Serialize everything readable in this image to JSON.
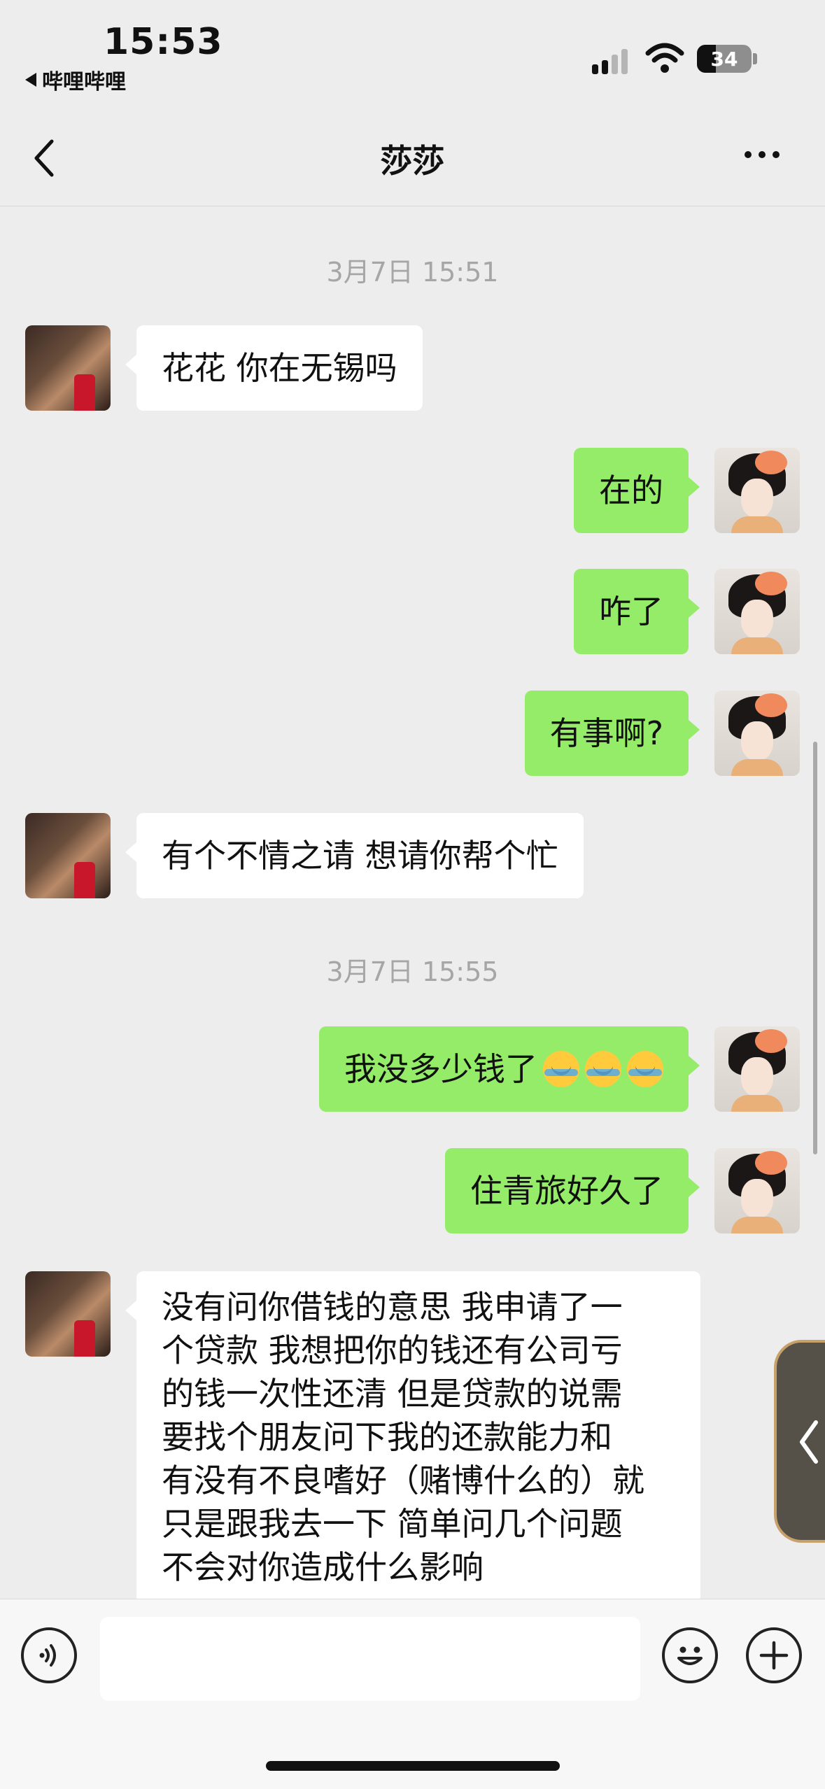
{
  "status_bar": {
    "time": "15:53",
    "back_app": "哔哩哔哩",
    "battery": "34"
  },
  "nav": {
    "title": "莎莎"
  },
  "messages": [
    {
      "type": "timestamp",
      "text": "3月7日 15:51"
    },
    {
      "type": "received",
      "text": "花花 你在无锡吗"
    },
    {
      "type": "sent",
      "text": "在的"
    },
    {
      "type": "sent",
      "text": "咋了"
    },
    {
      "type": "sent",
      "text": "有事啊?"
    },
    {
      "type": "received",
      "text": "有个不情之请 想请你帮个忙"
    },
    {
      "type": "timestamp",
      "text": "3月7日 15:55"
    },
    {
      "type": "sent",
      "text": "我没多少钱了",
      "emoji": [
        "crying-laughing-face",
        "crying-laughing-face",
        "crying-laughing-face"
      ]
    },
    {
      "type": "sent",
      "text": "住青旅好久了"
    },
    {
      "type": "received",
      "lines": [
        "没有问你借钱的意思 我申请了一",
        "个贷款 我想把你的钱还有公司亏",
        "的钱一次性还清 但是贷款的说需",
        "要找个朋友问下我的还款能力和",
        "有没有不良嗜好（赌博什么的）就",
        "只是跟我去一下 简单问几个问题",
        "不会对你造成什么影响"
      ]
    }
  ],
  "input_bar": {
    "placeholder": ""
  },
  "colors": {
    "background": "#ededed",
    "sent_bubble": "#95ec69",
    "received_bubble": "#ffffff",
    "timestamp": "#a6a6a6"
  }
}
